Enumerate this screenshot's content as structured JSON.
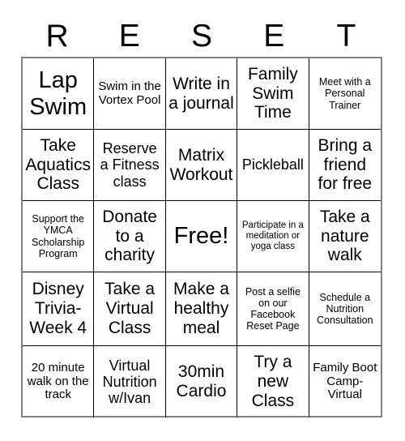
{
  "card": {
    "title_letters": [
      "R",
      "E",
      "S",
      "E",
      "T"
    ],
    "columns": 5,
    "rows": 5,
    "grid_border_color": "#808080",
    "cell_border_color": "#000000",
    "background_color": "#ffffff",
    "text_color": "#000000"
  },
  "cells": [
    {
      "text": "Lap Swim",
      "size": "fs-xl"
    },
    {
      "text": "Swim in the Vortex Pool",
      "size": "fs-sm"
    },
    {
      "text": "Write in a journal",
      "size": "fs-lg"
    },
    {
      "text": "Family Swim Time",
      "size": "fs-lg"
    },
    {
      "text": "Meet with a Personal Trainer",
      "size": "fs-xs"
    },
    {
      "text": "Take Aquatics Class",
      "size": "fs-lg"
    },
    {
      "text": "Reserve a Fitness class",
      "size": "fs-md"
    },
    {
      "text": "Matrix Workout",
      "size": "fs-lg"
    },
    {
      "text": "Pickleball",
      "size": "fs-md"
    },
    {
      "text": "Bring a friend for free",
      "size": "fs-lg"
    },
    {
      "text": "Support the YMCA Scholarship Program",
      "size": "fs-xs"
    },
    {
      "text": "Donate to a charity",
      "size": "fs-lg"
    },
    {
      "text": "Free!",
      "size": "fs-xl"
    },
    {
      "text": "Participate in a meditation or yoga class",
      "size": "fs-xxs"
    },
    {
      "text": "Take a nature walk",
      "size": "fs-lg"
    },
    {
      "text": "Disney Trivia-Week 4",
      "size": "fs-lg"
    },
    {
      "text": "Take a Virtual Class",
      "size": "fs-lg"
    },
    {
      "text": "Make a healthy meal",
      "size": "fs-lg"
    },
    {
      "text": "Post a selfie on our Facebook Reset Page",
      "size": "fs-xs"
    },
    {
      "text": "Schedule a Nutrition Consultation",
      "size": "fs-xs"
    },
    {
      "text": "20 minute walk on the track",
      "size": "fs-sm"
    },
    {
      "text": "Virtual Nutrition w/Ivan",
      "size": "fs-md"
    },
    {
      "text": "30min Cardio",
      "size": "fs-lg"
    },
    {
      "text": "Try a new Class",
      "size": "fs-lg"
    },
    {
      "text": "Family Boot Camp-Virtual",
      "size": "fs-sm"
    }
  ]
}
